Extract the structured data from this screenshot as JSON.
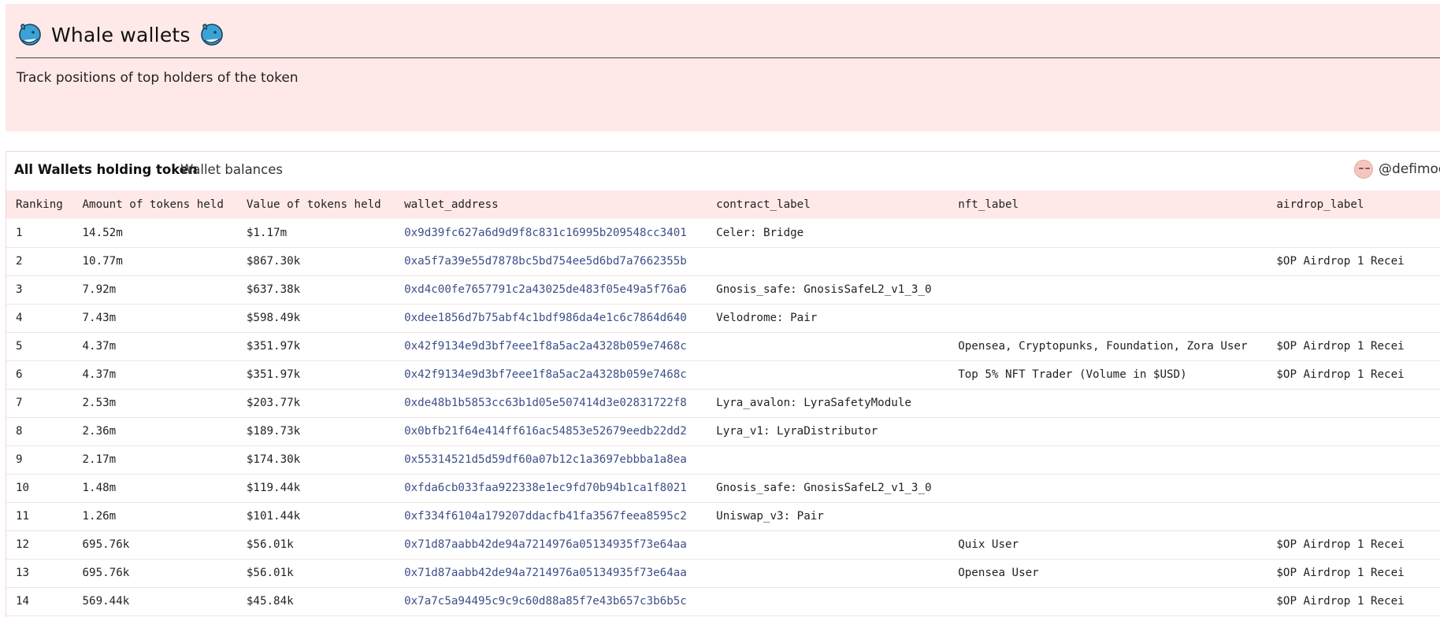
{
  "header": {
    "title": "Whale wallets",
    "subtitle": "Track positions of top holders of the token"
  },
  "card": {
    "tab_active": "All Wallets holding token",
    "tab_other": "Wallet balances",
    "author": "@defimoo"
  },
  "table": {
    "columns": [
      "Ranking",
      "Amount of tokens held",
      "Value of tokens held",
      "wallet_address",
      "contract_label",
      "nft_label",
      "airdrop_label"
    ],
    "rows": [
      [
        "1",
        "14.52m",
        "$1.17m",
        "0x9d39fc627a6d9d9f8c831c16995b209548cc3401",
        "Celer: Bridge",
        "",
        ""
      ],
      [
        "2",
        "10.77m",
        "$867.30k",
        "0xa5f7a39e55d7878bc5bd754ee5d6bd7a7662355b",
        "",
        "",
        "$OP Airdrop 1 Recei"
      ],
      [
        "3",
        "7.92m",
        "$637.38k",
        "0xd4c00fe7657791c2a43025de483f05e49a5f76a6",
        "Gnosis_safe: GnosisSafeL2_v1_3_0",
        "",
        ""
      ],
      [
        "4",
        "7.43m",
        "$598.49k",
        "0xdee1856d7b75abf4c1bdf986da4e1c6c7864d640",
        "Velodrome: Pair",
        "",
        ""
      ],
      [
        "5",
        "4.37m",
        "$351.97k",
        "0x42f9134e9d3bf7eee1f8a5ac2a4328b059e7468c",
        "",
        "Opensea, Cryptopunks, Foundation, Zora User",
        "$OP Airdrop 1 Recei"
      ],
      [
        "6",
        "4.37m",
        "$351.97k",
        "0x42f9134e9d3bf7eee1f8a5ac2a4328b059e7468c",
        "",
        "Top 5% NFT Trader (Volume in $USD)",
        "$OP Airdrop 1 Recei"
      ],
      [
        "7",
        "2.53m",
        "$203.77k",
        "0xde48b1b5853cc63b1d05e507414d3e02831722f8",
        "Lyra_avalon: LyraSafetyModule",
        "",
        ""
      ],
      [
        "8",
        "2.36m",
        "$189.73k",
        "0x0bfb21f64e414ff616ac54853e52679eedb22dd2",
        "Lyra_v1: LyraDistributor",
        "",
        ""
      ],
      [
        "9",
        "2.17m",
        "$174.30k",
        "0x55314521d5d59df60a07b12c1a3697ebbba1a8ea",
        "",
        "",
        ""
      ],
      [
        "10",
        "1.48m",
        "$119.44k",
        "0xfda6cb033faa922338e1ec9fd70b94b1ca1f8021",
        "Gnosis_safe: GnosisSafeL2_v1_3_0",
        "",
        ""
      ],
      [
        "11",
        "1.26m",
        "$101.44k",
        "0xf334f6104a179207ddacfb41fa3567feea8595c2",
        "Uniswap_v3: Pair",
        "",
        ""
      ],
      [
        "12",
        "695.76k",
        "$56.01k",
        "0x71d87aabb42de94a7214976a05134935f73e64aa",
        "",
        "Quix User",
        "$OP Airdrop 1 Recei"
      ],
      [
        "13",
        "695.76k",
        "$56.01k",
        "0x71d87aabb42de94a7214976a05134935f73e64aa",
        "",
        "Opensea User",
        "$OP Airdrop 1 Recei"
      ],
      [
        "14",
        "569.44k",
        "$45.84k",
        "0x7a7c5a94495c9c9c60d88a85f7e43b657c3b6b5c",
        "",
        "",
        "$OP Airdrop 1 Recei"
      ]
    ]
  },
  "colors": {
    "header_bg": "#ffe9e8",
    "address_text": "#3d4f88",
    "whale": "#3aa3d6"
  },
  "icons": [
    "whale-icon",
    "avatar"
  ]
}
